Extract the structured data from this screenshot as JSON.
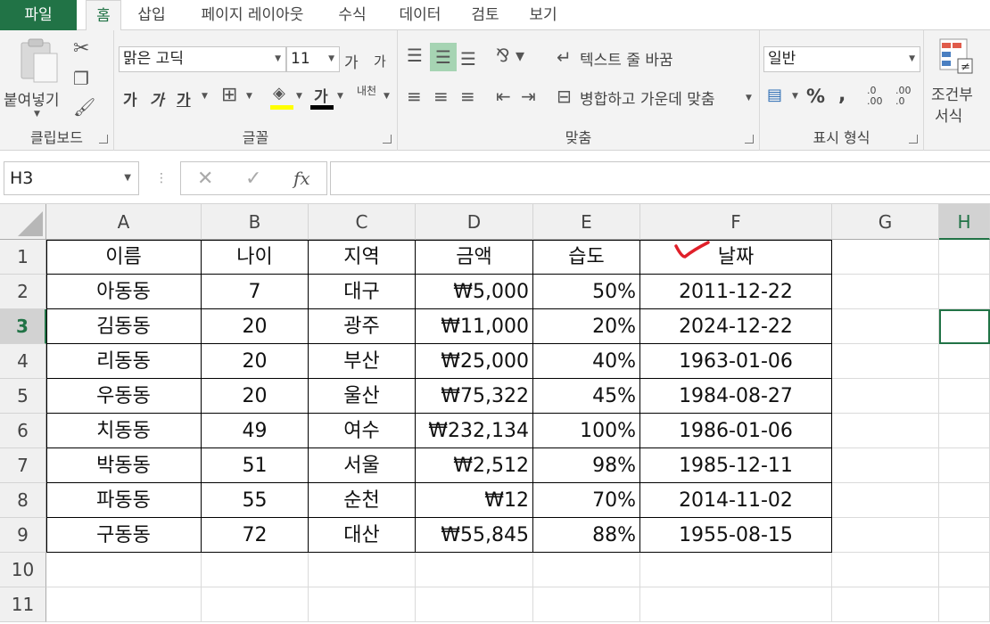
{
  "tabs": [
    "파일",
    "홈",
    "삽입",
    "페이지 레이아웃",
    "수식",
    "데이터",
    "검토",
    "보기"
  ],
  "clipboard": {
    "paste": "붙여넣기",
    "label": "클립보드"
  },
  "font": {
    "name": "맑은 고딕",
    "size": "11",
    "bold": "가",
    "italic": "가",
    "underline": "가",
    "grow": "가",
    "shrink": "가",
    "color_a": "가",
    "phonetic": "내천",
    "label": "글꼴"
  },
  "align": {
    "wrap": "텍스트 줄 바꿈",
    "merge": "병합하고 가운데 맞춤",
    "label": "맞춤"
  },
  "number": {
    "format": "일반",
    "percent": "%",
    "comma": ",",
    "inc": ".0\n.00",
    "dec": ".00\n.0",
    "label": "표시 형식"
  },
  "styles": {
    "cond_line1": "조건부",
    "cond_line2": "서식"
  },
  "formula_bar": {
    "name_box": "H3",
    "cancel": "✕",
    "enter": "✓",
    "fx": "fx",
    "content": ""
  },
  "colors": {
    "excel_green": "#217346",
    "highlight": "#ffff00",
    "font_red": "#c00000",
    "check_red": "#e0202a"
  },
  "sheet": {
    "columns": [
      "A",
      "B",
      "C",
      "D",
      "E",
      "F",
      "G",
      "H"
    ],
    "rows": [
      "1",
      "2",
      "3",
      "4",
      "5",
      "6",
      "7",
      "8",
      "9",
      "10",
      "11"
    ],
    "active_cell": "H3",
    "data": [
      [
        "이름",
        "나이",
        "지역",
        "금액",
        "습도",
        "날짜"
      ],
      [
        "아동동",
        "7",
        "대구",
        "₩5,000",
        "50%",
        "2011-12-22"
      ],
      [
        "김동동",
        "20",
        "광주",
        "₩11,000",
        "20%",
        "2024-12-22"
      ],
      [
        "리동동",
        "20",
        "부산",
        "₩25,000",
        "40%",
        "1963-01-06"
      ],
      [
        "우동동",
        "20",
        "울산",
        "₩75,322",
        "45%",
        "1984-08-27"
      ],
      [
        "치동동",
        "49",
        "여수",
        "₩232,134",
        "100%",
        "1986-01-06"
      ],
      [
        "박동동",
        "51",
        "서울",
        "₩2,512",
        "98%",
        "1985-12-11"
      ],
      [
        "파동동",
        "55",
        "순천",
        "₩12",
        "70%",
        "2014-11-02"
      ],
      [
        "구동동",
        "72",
        "대산",
        "₩55,845",
        "88%",
        "1955-08-15"
      ]
    ]
  }
}
